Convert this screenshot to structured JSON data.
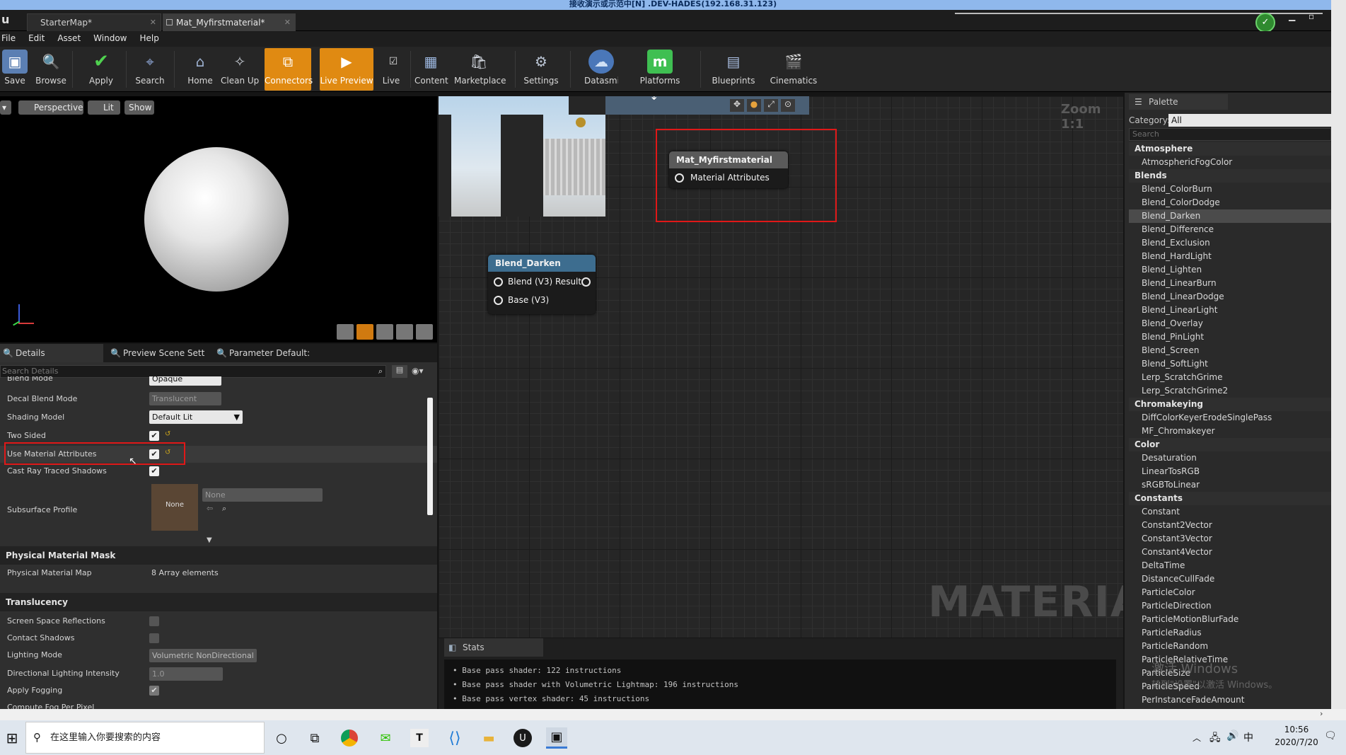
{
  "remote_title": "接收演示或示范中[N] .DEV-HADES(192.168.31.123)",
  "tabs": [
    {
      "label": "StarterMap*"
    },
    {
      "label": "Mat_Myfirstmaterial*"
    }
  ],
  "menu": [
    "File",
    "Edit",
    "Asset",
    "Window",
    "Help"
  ],
  "toolbar": [
    {
      "label": "Save",
      "icon": "save-icon"
    },
    {
      "label": "Browse",
      "icon": "browse-icon"
    },
    {
      "label": "Apply",
      "icon": "apply-icon"
    },
    {
      "label": "Search",
      "icon": "search-icon"
    },
    {
      "label": "Home",
      "icon": "home-icon"
    },
    {
      "label": "Clean Up",
      "icon": "clean-up-icon"
    },
    {
      "label": "Connectors",
      "icon": "connectors-icon",
      "active": true
    },
    {
      "label": "Live Preview",
      "icon": "live-preview-icon",
      "active": true
    },
    {
      "label": "Live",
      "icon": "live-icon"
    },
    {
      "label": "Content",
      "icon": "content-icon"
    },
    {
      "label": "Marketplace",
      "icon": "marketplace-icon"
    },
    {
      "label": "Settings",
      "icon": "settings-icon"
    },
    {
      "label": "Datasmith",
      "icon": "datasmith-icon"
    },
    {
      "label": "Platforms",
      "icon": "platforms-icon"
    },
    {
      "label": "Blueprints",
      "icon": "blueprints-icon"
    },
    {
      "label": "Cinematics",
      "icon": "cinematics-icon"
    }
  ],
  "viewport": {
    "perspective": "Perspective",
    "lit": "Lit",
    "show": "Show"
  },
  "details_tabs": [
    "Details",
    "Preview Scene Sett",
    "Parameter Default:"
  ],
  "details_search_placeholder": "Search Details",
  "props": {
    "blend_mode": {
      "label": "Blend Mode",
      "value": "Opaque"
    },
    "decal_blend_mode": {
      "label": "Decal Blend Mode",
      "value": "Translucent"
    },
    "shading_model": {
      "label": "Shading Model",
      "value": "Default Lit"
    },
    "two_sided": {
      "label": "Two Sided",
      "checked": true
    },
    "use_material_attributes": {
      "label": "Use Material Attributes",
      "checked": true
    },
    "cast_ray_traced_shadows": {
      "label": "Cast Ray Traced Shadows",
      "checked": true
    },
    "subsurface_profile": {
      "label": "Subsurface Profile",
      "thumb": "None",
      "value": "None"
    }
  },
  "sections": {
    "physical_material_mask": "Physical Material Mask",
    "physical_material_map": {
      "label": "Physical Material Map",
      "value": "8 Array elements"
    },
    "translucency": "Translucency"
  },
  "translucency_props": {
    "ssr": {
      "label": "Screen Space Reflections"
    },
    "contact_shadows": {
      "label": "Contact Shadows"
    },
    "lighting_mode": {
      "label": "Lighting Mode",
      "value": "Volumetric NonDirectional"
    },
    "directional_lighting_intensity": {
      "label": "Directional Lighting Intensity",
      "value": "1.0"
    },
    "apply_fogging": {
      "label": "Apply Fogging",
      "checked": true
    },
    "compute_fog": {
      "label": "Compute Fog Per Pixel"
    }
  },
  "graph": {
    "zoom": "Zoom 1:1",
    "watermark": "MATERIAL",
    "material_node": {
      "title": "Mat_Myfirstmaterial",
      "pin": "Material Attributes"
    },
    "blend_node": {
      "title": "Blend_Darken",
      "pins": [
        "Blend (V3) Result",
        "Base (V3)"
      ]
    }
  },
  "stats": {
    "tab": "Stats",
    "lines": [
      "Base pass shader: 122 instructions",
      "Base pass shader with Volumetric Lightmap: 196 instructions",
      "Base pass vertex shader: 45 instructions"
    ]
  },
  "palette": {
    "title": "Palette",
    "category_label": "Category:",
    "category_value": "All",
    "search_placeholder": "Search",
    "groups": [
      {
        "name": "Atmosphere",
        "items": [
          "AtmosphericFogColor"
        ]
      },
      {
        "name": "Blends",
        "items": [
          "Blend_ColorBurn",
          "Blend_ColorDodge",
          "Blend_Darken",
          "Blend_Difference",
          "Blend_Exclusion",
          "Blend_HardLight",
          "Blend_Lighten",
          "Blend_LinearBurn",
          "Blend_LinearDodge",
          "Blend_LinearLight",
          "Blend_Overlay",
          "Blend_PinLight",
          "Blend_Screen",
          "Blend_SoftLight",
          "Lerp_ScratchGrime",
          "Lerp_ScratchGrime2"
        ]
      },
      {
        "name": "Chromakeying",
        "items": [
          "DiffColorKeyerErodeSinglePass",
          "MF_Chromakeyer"
        ]
      },
      {
        "name": "Color",
        "items": [
          "Desaturation",
          "LinearTosRGB",
          "sRGBToLinear"
        ]
      },
      {
        "name": "Constants",
        "items": [
          "Constant",
          "Constant2Vector",
          "Constant3Vector",
          "Constant4Vector",
          "DeltaTime",
          "DistanceCullFade",
          "ParticleColor",
          "ParticleDirection",
          "ParticleMotionBlurFade",
          "ParticleRadius",
          "ParticleRandom",
          "ParticleRelativeTime",
          "ParticleSize",
          "ParticleSpeed",
          "PerInstanceFadeAmount"
        ]
      }
    ],
    "selected": "Blend_Darken"
  },
  "activation": {
    "line1": "激活 Windows",
    "line2": "转到\"设置\"以激活 Windows。"
  },
  "taskbar": {
    "search_placeholder": "在这里输入你要搜索的内容",
    "ime": "中",
    "time": "10:56",
    "date": "2020/7/20"
  },
  "colors": {
    "accent": "#e08a12",
    "highlight": "#e01818",
    "node_header_material": "#5a5a5a",
    "node_header_blend": "#3d6d8f"
  }
}
